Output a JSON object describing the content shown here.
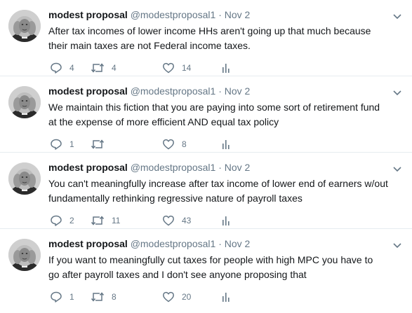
{
  "tweets": [
    {
      "name": "modest proposal",
      "handle": "@modestproposal1",
      "separator": "·",
      "date": "Nov 2",
      "text_lines": [
        "After tax incomes of lower income HHs aren't going up that much because",
        "their main taxes are not Federal income taxes."
      ],
      "replies": "4",
      "retweets": "4",
      "likes": "14"
    },
    {
      "name": "modest proposal",
      "handle": "@modestproposal1",
      "separator": "·",
      "date": "Nov 2",
      "text_lines": [
        "We maintain this fiction that you are paying into some sort of retirement fund",
        "at the expense of more efficient AND equal tax policy"
      ],
      "replies": "1",
      "retweets": "",
      "likes": "8"
    },
    {
      "name": "modest proposal",
      "handle": "@modestproposal1",
      "separator": "·",
      "date": "Nov 2",
      "text_lines": [
        "You can't meaningfully increase after tax income of lower end of earners w/out",
        "fundamentally rethinking regressive nature of payroll taxes"
      ],
      "replies": "2",
      "retweets": "11",
      "likes": "43"
    },
    {
      "name": "modest proposal",
      "handle": "@modestproposal1",
      "separator": "·",
      "date": "Nov 2",
      "text_lines": [
        "If you want to meaningfully cut taxes for people with high MPC you have to",
        "go after payroll taxes and I don't see anyone proposing that"
      ],
      "replies": "1",
      "retweets": "8",
      "likes": "20"
    }
  ],
  "icons": {
    "reply": "reply-icon",
    "retweet": "retweet-icon",
    "like": "heart-icon",
    "stats": "analytics-icon",
    "caret": "chevron-down-icon"
  },
  "colors": {
    "text": "#14171a",
    "secondary": "#657786",
    "icon": "#657786",
    "divider": "#e6ecf0"
  }
}
